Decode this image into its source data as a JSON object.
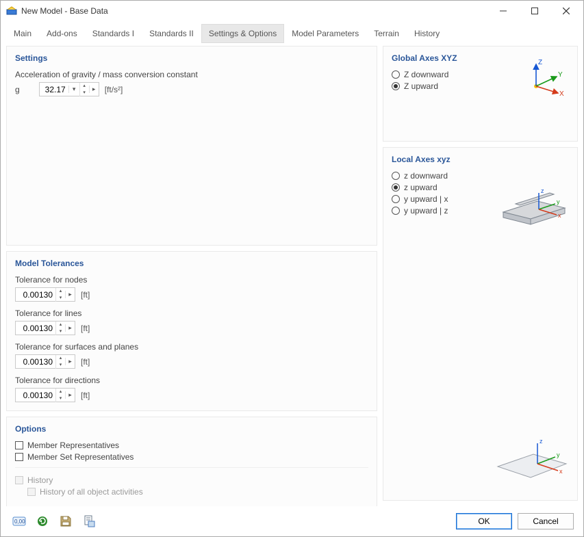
{
  "window": {
    "title": "New Model - Base Data"
  },
  "tabs": {
    "items": [
      "Main",
      "Add-ons",
      "Standards I",
      "Standards II",
      "Settings & Options",
      "Model Parameters",
      "Terrain",
      "History"
    ],
    "active_index": 4
  },
  "settings_panel": {
    "title": "Settings",
    "gravity_label": "Acceleration of gravity / mass conversion constant",
    "g_symbol": "g",
    "g_value": "32.17",
    "g_unit": "[ft/s²]"
  },
  "tolerances_panel": {
    "title": "Model Tolerances",
    "items": [
      {
        "label": "Tolerance for nodes",
        "value": "0.00130",
        "unit": "[ft]"
      },
      {
        "label": "Tolerance for lines",
        "value": "0.00130",
        "unit": "[ft]"
      },
      {
        "label": "Tolerance for surfaces and planes",
        "value": "0.00130",
        "unit": "[ft]"
      },
      {
        "label": "Tolerance for directions",
        "value": "0.00130",
        "unit": "[ft]"
      }
    ]
  },
  "options_panel": {
    "title": "Options",
    "member_repr": "Member Representatives",
    "member_set_repr": "Member Set Representatives",
    "history": "History",
    "history_all": "History of all object activities"
  },
  "global_axes_panel": {
    "title": "Global Axes XYZ",
    "opt_down": "Z downward",
    "opt_up": "Z upward"
  },
  "local_axes_panel": {
    "title": "Local Axes xyz",
    "opts": [
      "z downward",
      "z upward",
      "y upward | x",
      "y upward | z"
    ],
    "selected_index": 1
  },
  "footer": {
    "ok": "OK",
    "cancel": "Cancel"
  }
}
